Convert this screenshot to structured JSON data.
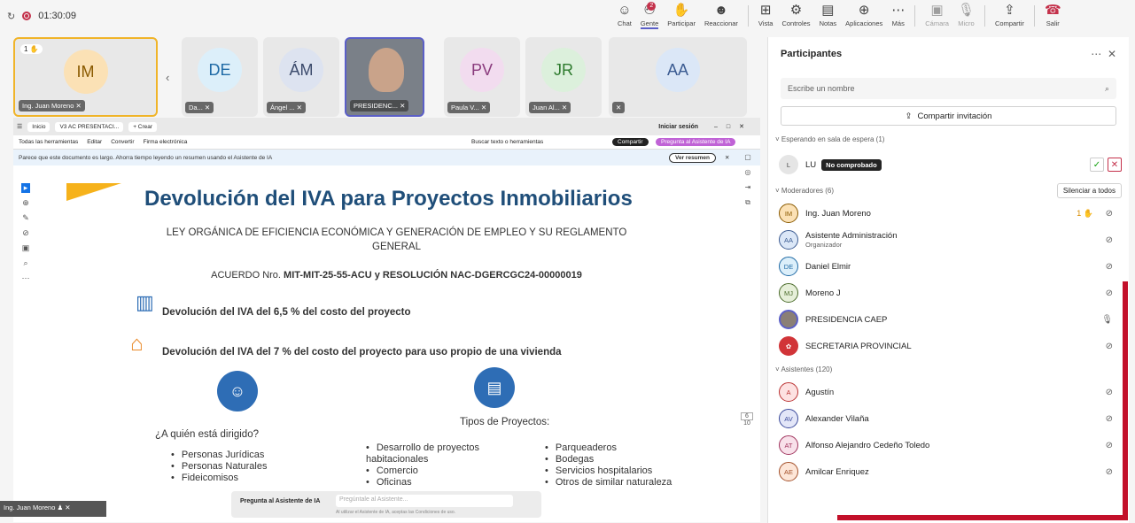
{
  "meeting": {
    "timer": "01:30:09"
  },
  "toolbar": [
    {
      "label": "Chat",
      "icon": "chat-icon"
    },
    {
      "label": "Gente",
      "icon": "people-icon",
      "badge": "2",
      "active": true
    },
    {
      "label": "Participar",
      "icon": "hand-icon"
    },
    {
      "label": "Reaccionar",
      "icon": "smile-icon"
    },
    {
      "label": "Vista",
      "icon": "grid-icon"
    },
    {
      "label": "Controles",
      "icon": "controls-icon"
    },
    {
      "label": "Notas",
      "icon": "notes-icon"
    },
    {
      "label": "Aplicaciones",
      "icon": "apps-icon"
    },
    {
      "label": "Más",
      "icon": "more-icon"
    },
    {
      "label": "Cámara",
      "icon": "camera-off-icon",
      "dim": true
    },
    {
      "label": "Micro",
      "icon": "mic-off-icon",
      "dim": true
    },
    {
      "label": "Compartir",
      "icon": "share-icon"
    },
    {
      "label": "Salir",
      "icon": "leave-icon"
    }
  ],
  "tiles": [
    {
      "initials": "IM",
      "name": "Ing. Juan Moreno",
      "raised": "1",
      "color": "#fbe1b5",
      "textc": "#8a5a00"
    },
    {
      "initials": "DE",
      "name": "Da...",
      "color": "#dceffa",
      "textc": "#1f6aa5"
    },
    {
      "initials": "ÁM",
      "name": "Ángel ...",
      "color": "#dde3f0",
      "textc": "#3b4a6b"
    },
    {
      "initials": "",
      "name": "PRESIDENC...",
      "video": true
    },
    {
      "initials": "PV",
      "name": "Paula V...",
      "color": "#f2dcef",
      "textc": "#8a3b7d"
    },
    {
      "initials": "JR",
      "name": "Juan Al...",
      "color": "#dcf0dc",
      "textc": "#2d7a2d"
    },
    {
      "initials": "AA",
      "name": "",
      "color": "#dbe7f7",
      "textc": "#3b5b91"
    }
  ],
  "browser": {
    "tabs": [
      "Inicio",
      "V3 AC PRESENTACI...",
      "+ Crear"
    ],
    "signin": "Iniciar sesión",
    "menu": [
      "Todas las herramientas",
      "Editar",
      "Convertir",
      "Firma electrónica"
    ],
    "search_tools": "Buscar texto o herramientas",
    "share": "Compartir",
    "ai_btn": "Pregunta al Asistente de IA",
    "notice": "Parece que este documento es largo. Ahorra tiempo leyendo un resumen usando el Asistente de IA",
    "summary_btn": "Ver resumen",
    "page_nums": [
      "6",
      "10"
    ]
  },
  "doc": {
    "title": "Devolución del IVA para Proyectos Inmobiliarios",
    "law1": "LEY ORGÁNICA DE EFICIENCIA ECONÓMICA Y GENERACIÓN DE EMPLEO Y SU REGLAMENTO",
    "law2": "GENERAL",
    "acuerdo_pre": "ACUERDO Nro.",
    "acuerdo_bold": "MIT-MIT-25-55-ACU y RESOLUCIÓN NAC-DGERCGC24-00000019",
    "line1": "Devolución del IVA del 6,5 % del costo del proyecto",
    "line2": "Devolución del IVA del 7 % del costo del proyecto para uso propio de una vivienda",
    "who": "¿A quién está dirigido?",
    "who_items": [
      "Personas Jurídicas",
      "Personas Naturales",
      "Fideicomisos"
    ],
    "types": "Tipos de Proyectos:",
    "types_a": [
      "Desarrollo de proyectos habitacionales",
      "Comercio",
      "Oficinas"
    ],
    "types_b": [
      "Parqueaderos",
      "Bodegas",
      "Servicios hospitalarios",
      "Otros de similar naturaleza"
    ]
  },
  "ai_bar": {
    "label": "Pregunta al Asistente de IA",
    "placeholder": "Pregúntale al Asistente...",
    "note": "Al utilizar el Asistente de IA, aceptas las Condiciones de uso."
  },
  "self_view": "Ing. Juan Moreno",
  "panel": {
    "title": "Participantes",
    "search": "Escribe un nombre",
    "invite": "Compartir invitación",
    "waiting": "Esperando en sala de espera (1)",
    "waiting_user": {
      "initials": "L",
      "name": "LU",
      "tag": "No comprobado"
    },
    "moderators": "Moderadores (6)",
    "silence": "Silenciar a todos",
    "mods": [
      {
        "initials": "IM",
        "name": "Ing. Juan Moreno",
        "color": "#fbe1b5",
        "textc": "#8a5a00",
        "raise": "1"
      },
      {
        "initials": "AA",
        "name": "Asistente Administración",
        "sub": "Organizador",
        "color": "#dbe7f7",
        "textc": "#3b5b91"
      },
      {
        "initials": "DE",
        "name": "Daniel Elmir",
        "color": "#dceffa",
        "textc": "#1f6aa5"
      },
      {
        "initials": "MJ",
        "name": "Moreno J",
        "color": "#e6efd9",
        "textc": "#4a6b2a"
      },
      {
        "initials": "",
        "name": "PRESIDENCIA CAEP",
        "photo": true,
        "mic_on": true
      },
      {
        "initials": "",
        "name": "SECRETARIA PROVINCIAL",
        "logo": true
      }
    ],
    "attendees": "Asistentes (120)",
    "atts": [
      {
        "initials": "A",
        "name": "Agustín",
        "color": "#fde2e2",
        "textc": "#b33"
      },
      {
        "initials": "AV",
        "name": "Alexander Vilaña",
        "color": "#e3e6f8",
        "textc": "#3b4a9b"
      },
      {
        "initials": "AT",
        "name": "Alfonso Alejandro Cedeño Toledo",
        "color": "#f8e1ea",
        "textc": "#a1365f"
      },
      {
        "initials": "AE",
        "name": "Amilcar Enriquez",
        "color": "#fde6d8",
        "textc": "#a4502a"
      }
    ]
  }
}
